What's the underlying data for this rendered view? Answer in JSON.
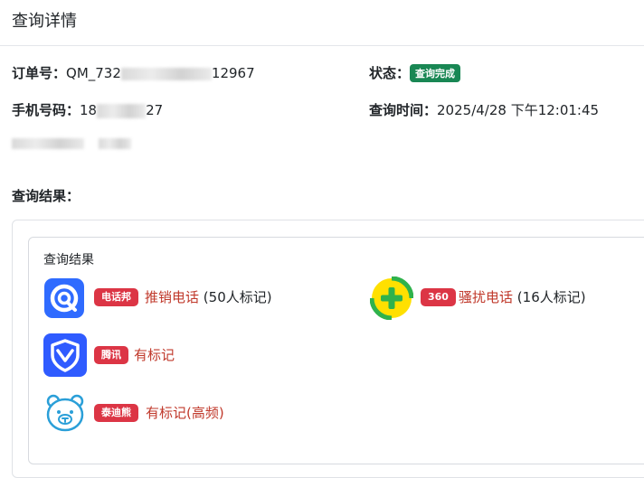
{
  "header": {
    "title": "查询详情"
  },
  "info": {
    "order_label": "订单号：",
    "order_prefix": "QM_732",
    "order_suffix": "12967",
    "status_label": "状态：",
    "status_value": "查询完成",
    "phone_label": "手机号码：",
    "phone_prefix": "18",
    "phone_suffix": "27",
    "time_label": "查询时间：",
    "time_value": "2025/4/28 下午12:01:45"
  },
  "section": {
    "title": "查询结果："
  },
  "results": {
    "title": "查询结果",
    "items": [
      {
        "source": "电话邦",
        "label": "推销电话",
        "count": "(50人标记)",
        "icon": "diantangbang-logo-icon"
      },
      {
        "source": "360",
        "label": "骚扰电话",
        "count": "(16人标记)",
        "icon": "360-logo-icon"
      },
      {
        "source": "腾讯",
        "label": "有标记",
        "count": "",
        "icon": "tencent-shield-logo-icon"
      },
      {
        "source": "泰迪熊",
        "label": "有标记(高频)",
        "count": "",
        "icon": "teddy-bear-logo-icon"
      }
    ]
  },
  "colors": {
    "status_badge": "#198754",
    "source_badge": "#dc3545",
    "result_text": "#c0392b",
    "logo_blue": "#2f6bff",
    "logo_360_yellow": "#ffe000",
    "logo_360_green": "#2fb24c"
  }
}
